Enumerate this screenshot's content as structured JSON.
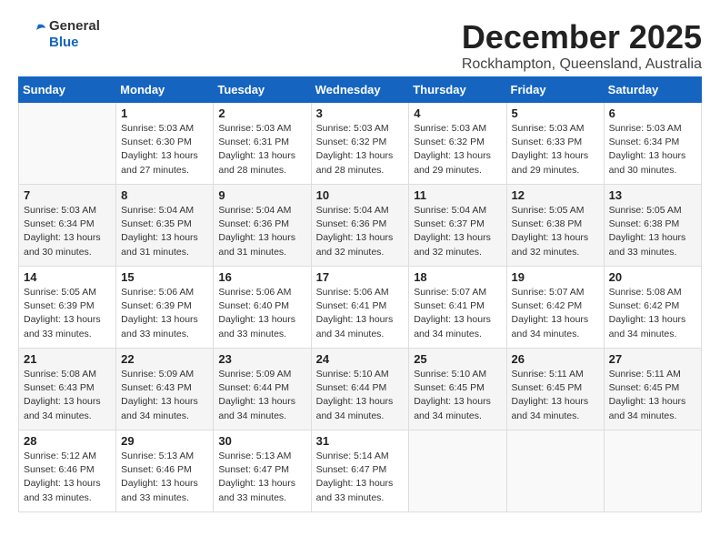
{
  "header": {
    "logo_general": "General",
    "logo_blue": "Blue",
    "month_title": "December 2025",
    "location": "Rockhampton, Queensland, Australia"
  },
  "weekdays": [
    "Sunday",
    "Monday",
    "Tuesday",
    "Wednesday",
    "Thursday",
    "Friday",
    "Saturday"
  ],
  "weeks": [
    [
      {
        "day": "",
        "sunrise": "",
        "sunset": "",
        "daylight": ""
      },
      {
        "day": "1",
        "sunrise": "Sunrise: 5:03 AM",
        "sunset": "Sunset: 6:30 PM",
        "daylight": "Daylight: 13 hours and 27 minutes."
      },
      {
        "day": "2",
        "sunrise": "Sunrise: 5:03 AM",
        "sunset": "Sunset: 6:31 PM",
        "daylight": "Daylight: 13 hours and 28 minutes."
      },
      {
        "day": "3",
        "sunrise": "Sunrise: 5:03 AM",
        "sunset": "Sunset: 6:32 PM",
        "daylight": "Daylight: 13 hours and 28 minutes."
      },
      {
        "day": "4",
        "sunrise": "Sunrise: 5:03 AM",
        "sunset": "Sunset: 6:32 PM",
        "daylight": "Daylight: 13 hours and 29 minutes."
      },
      {
        "day": "5",
        "sunrise": "Sunrise: 5:03 AM",
        "sunset": "Sunset: 6:33 PM",
        "daylight": "Daylight: 13 hours and 29 minutes."
      },
      {
        "day": "6",
        "sunrise": "Sunrise: 5:03 AM",
        "sunset": "Sunset: 6:34 PM",
        "daylight": "Daylight: 13 hours and 30 minutes."
      }
    ],
    [
      {
        "day": "7",
        "sunrise": "Sunrise: 5:03 AM",
        "sunset": "Sunset: 6:34 PM",
        "daylight": "Daylight: 13 hours and 30 minutes."
      },
      {
        "day": "8",
        "sunrise": "Sunrise: 5:04 AM",
        "sunset": "Sunset: 6:35 PM",
        "daylight": "Daylight: 13 hours and 31 minutes."
      },
      {
        "day": "9",
        "sunrise": "Sunrise: 5:04 AM",
        "sunset": "Sunset: 6:36 PM",
        "daylight": "Daylight: 13 hours and 31 minutes."
      },
      {
        "day": "10",
        "sunrise": "Sunrise: 5:04 AM",
        "sunset": "Sunset: 6:36 PM",
        "daylight": "Daylight: 13 hours and 32 minutes."
      },
      {
        "day": "11",
        "sunrise": "Sunrise: 5:04 AM",
        "sunset": "Sunset: 6:37 PM",
        "daylight": "Daylight: 13 hours and 32 minutes."
      },
      {
        "day": "12",
        "sunrise": "Sunrise: 5:05 AM",
        "sunset": "Sunset: 6:38 PM",
        "daylight": "Daylight: 13 hours and 32 minutes."
      },
      {
        "day": "13",
        "sunrise": "Sunrise: 5:05 AM",
        "sunset": "Sunset: 6:38 PM",
        "daylight": "Daylight: 13 hours and 33 minutes."
      }
    ],
    [
      {
        "day": "14",
        "sunrise": "Sunrise: 5:05 AM",
        "sunset": "Sunset: 6:39 PM",
        "daylight": "Daylight: 13 hours and 33 minutes."
      },
      {
        "day": "15",
        "sunrise": "Sunrise: 5:06 AM",
        "sunset": "Sunset: 6:39 PM",
        "daylight": "Daylight: 13 hours and 33 minutes."
      },
      {
        "day": "16",
        "sunrise": "Sunrise: 5:06 AM",
        "sunset": "Sunset: 6:40 PM",
        "daylight": "Daylight: 13 hours and 33 minutes."
      },
      {
        "day": "17",
        "sunrise": "Sunrise: 5:06 AM",
        "sunset": "Sunset: 6:41 PM",
        "daylight": "Daylight: 13 hours and 34 minutes."
      },
      {
        "day": "18",
        "sunrise": "Sunrise: 5:07 AM",
        "sunset": "Sunset: 6:41 PM",
        "daylight": "Daylight: 13 hours and 34 minutes."
      },
      {
        "day": "19",
        "sunrise": "Sunrise: 5:07 AM",
        "sunset": "Sunset: 6:42 PM",
        "daylight": "Daylight: 13 hours and 34 minutes."
      },
      {
        "day": "20",
        "sunrise": "Sunrise: 5:08 AM",
        "sunset": "Sunset: 6:42 PM",
        "daylight": "Daylight: 13 hours and 34 minutes."
      }
    ],
    [
      {
        "day": "21",
        "sunrise": "Sunrise: 5:08 AM",
        "sunset": "Sunset: 6:43 PM",
        "daylight": "Daylight: 13 hours and 34 minutes."
      },
      {
        "day": "22",
        "sunrise": "Sunrise: 5:09 AM",
        "sunset": "Sunset: 6:43 PM",
        "daylight": "Daylight: 13 hours and 34 minutes."
      },
      {
        "day": "23",
        "sunrise": "Sunrise: 5:09 AM",
        "sunset": "Sunset: 6:44 PM",
        "daylight": "Daylight: 13 hours and 34 minutes."
      },
      {
        "day": "24",
        "sunrise": "Sunrise: 5:10 AM",
        "sunset": "Sunset: 6:44 PM",
        "daylight": "Daylight: 13 hours and 34 minutes."
      },
      {
        "day": "25",
        "sunrise": "Sunrise: 5:10 AM",
        "sunset": "Sunset: 6:45 PM",
        "daylight": "Daylight: 13 hours and 34 minutes."
      },
      {
        "day": "26",
        "sunrise": "Sunrise: 5:11 AM",
        "sunset": "Sunset: 6:45 PM",
        "daylight": "Daylight: 13 hours and 34 minutes."
      },
      {
        "day": "27",
        "sunrise": "Sunrise: 5:11 AM",
        "sunset": "Sunset: 6:45 PM",
        "daylight": "Daylight: 13 hours and 34 minutes."
      }
    ],
    [
      {
        "day": "28",
        "sunrise": "Sunrise: 5:12 AM",
        "sunset": "Sunset: 6:46 PM",
        "daylight": "Daylight: 13 hours and 33 minutes."
      },
      {
        "day": "29",
        "sunrise": "Sunrise: 5:13 AM",
        "sunset": "Sunset: 6:46 PM",
        "daylight": "Daylight: 13 hours and 33 minutes."
      },
      {
        "day": "30",
        "sunrise": "Sunrise: 5:13 AM",
        "sunset": "Sunset: 6:47 PM",
        "daylight": "Daylight: 13 hours and 33 minutes."
      },
      {
        "day": "31",
        "sunrise": "Sunrise: 5:14 AM",
        "sunset": "Sunset: 6:47 PM",
        "daylight": "Daylight: 13 hours and 33 minutes."
      },
      {
        "day": "",
        "sunrise": "",
        "sunset": "",
        "daylight": ""
      },
      {
        "day": "",
        "sunrise": "",
        "sunset": "",
        "daylight": ""
      },
      {
        "day": "",
        "sunrise": "",
        "sunset": "",
        "daylight": ""
      }
    ]
  ]
}
